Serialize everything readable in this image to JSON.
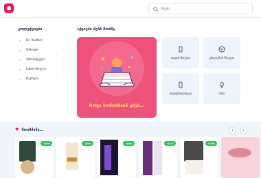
{
  "header": {
    "search_placeholder": "ძიება"
  },
  "sidebar": {
    "title": "კოლექციები",
    "items": [
      {
        "label": "Dr. Kozhel"
      },
      {
        "label": "ჩანთები"
      },
      {
        "label": "არომატული"
      },
      {
        "label": "სახის მოვლა"
      },
      {
        "label": "ნაკრები"
      }
    ]
  },
  "categories": {
    "title": "აქციები ძებნ მოძმე",
    "banner_caption": "როცა ხორისხიან ეძებ...",
    "tiles": [
      {
        "label": "თავის მოვლა",
        "icon": "bottle-icon"
      },
      {
        "label": "კბილების მოვლა",
        "icon": "tooth-icon"
      },
      {
        "label": "ჰიგიენოლოგია",
        "icon": "phone-icon"
      },
      {
        "label": "იიმა",
        "icon": "gender-icon"
      }
    ]
  },
  "products": {
    "title": "მოიმძაძე...",
    "items": [
      {
        "discount": "-24%"
      },
      {
        "discount": "-25%"
      },
      {
        "discount": "-15%"
      },
      {
        "discount": "-21%"
      },
      {
        "discount": "-25%"
      },
      {
        "discount": ""
      }
    ]
  },
  "colors": {
    "brand": "#e61e54",
    "banner": "#ee5179",
    "discount": "#22c55e",
    "section_bg": "#f0f5fb"
  }
}
